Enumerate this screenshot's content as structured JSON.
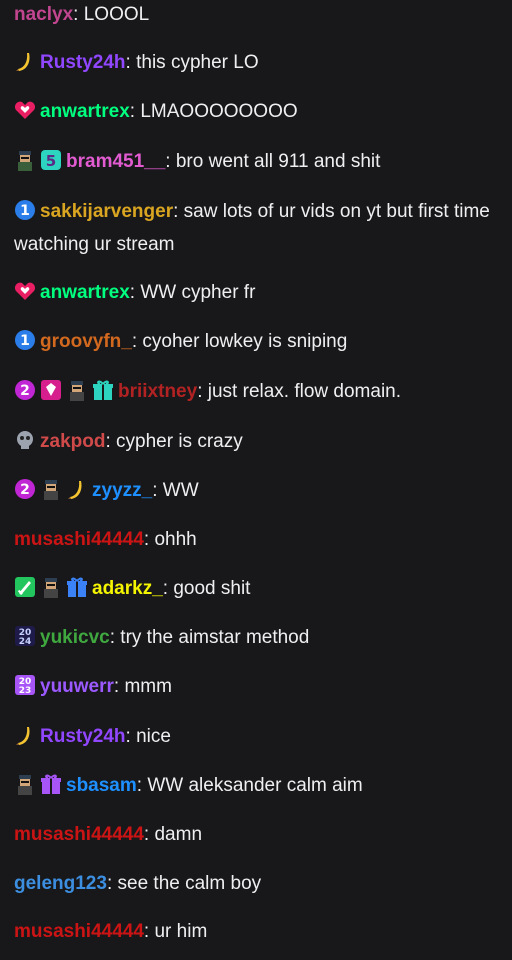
{
  "colors": {
    "background": "#18181b",
    "text": "#efeff1",
    "naclyx": "#c2458f",
    "rusty": "#9147ff",
    "anwartrex": "#00ff7f",
    "bram": "#e25bd1",
    "sakki": "#daa520",
    "groovy": "#d2691e",
    "briixtney": "#b22222",
    "zakpod": "#d14a4a",
    "zyyzz": "#1e90ff",
    "musashi": "#cc1414",
    "adarkz": "#f5f500",
    "yukicvc": "#3fa83f",
    "yuuwerr": "#9b59ff",
    "sbasam": "#1e90ff",
    "geleng": "#3c8fe0"
  },
  "messages": [
    {
      "user": "naclyx",
      "text": "LOOOL",
      "badges": []
    },
    {
      "user": "Rusty24h",
      "text": "this cypher LO",
      "badges": [
        "banana-icon"
      ]
    },
    {
      "user": "anwartrex",
      "text": "LMAOOOOOOOO",
      "badges": [
        "heart-badge-icon"
      ]
    },
    {
      "user": "bram451__",
      "text": "bro went all 911 and shit",
      "badges": [
        "character-badge-icon",
        "cyan-5-badge-icon"
      ]
    },
    {
      "user": "sakkijarvenger",
      "text": "saw lots of ur vids on yt but first time watching ur stream",
      "badges": [
        "one-badge-icon"
      ]
    },
    {
      "user": "anwartrex",
      "text": "WW cypher fr",
      "badges": [
        "heart-badge-icon"
      ]
    },
    {
      "user": "groovyfn_",
      "text": "cyoher lowkey is sniping",
      "badges": [
        "one-badge-icon"
      ]
    },
    {
      "user": "briixtney",
      "text": "just relax. flow domain.",
      "badges": [
        "two-badge-icon",
        "gem-badge-icon",
        "character-badge-icon",
        "gift-badge-icon"
      ]
    },
    {
      "user": "zakpod",
      "text": "cypher is crazy",
      "badges": [
        "skull-badge-icon"
      ]
    },
    {
      "user": "zyyzz_",
      "text": "WW",
      "badges": [
        "two-badge-icon",
        "character-badge-icon",
        "banana-icon"
      ]
    },
    {
      "user": "musashi44444",
      "text": "ohhh",
      "badges": []
    },
    {
      "user": "adarkz_",
      "text": "good shit",
      "badges": [
        "sword-badge-icon",
        "character-badge-icon",
        "gift-badge-icon"
      ]
    },
    {
      "user": "yukicvc",
      "text": "try the aimstar method",
      "badges": [
        "2024-badge-icon"
      ]
    },
    {
      "user": "yuuwerr",
      "text": "mmm",
      "badges": [
        "2023-badge-icon"
      ]
    },
    {
      "user": "Rusty24h",
      "text": "nice",
      "badges": [
        "banana-icon"
      ]
    },
    {
      "user": "sbasam",
      "text": "WW aleksander calm aim",
      "badges": [
        "character-badge-icon",
        "gift-badge-icon"
      ]
    },
    {
      "user": "musashi44444",
      "text": "damn",
      "badges": []
    },
    {
      "user": "geleng123",
      "text": "see the calm boy",
      "badges": []
    },
    {
      "user": "musashi44444",
      "text": "ur him",
      "badges": []
    }
  ]
}
